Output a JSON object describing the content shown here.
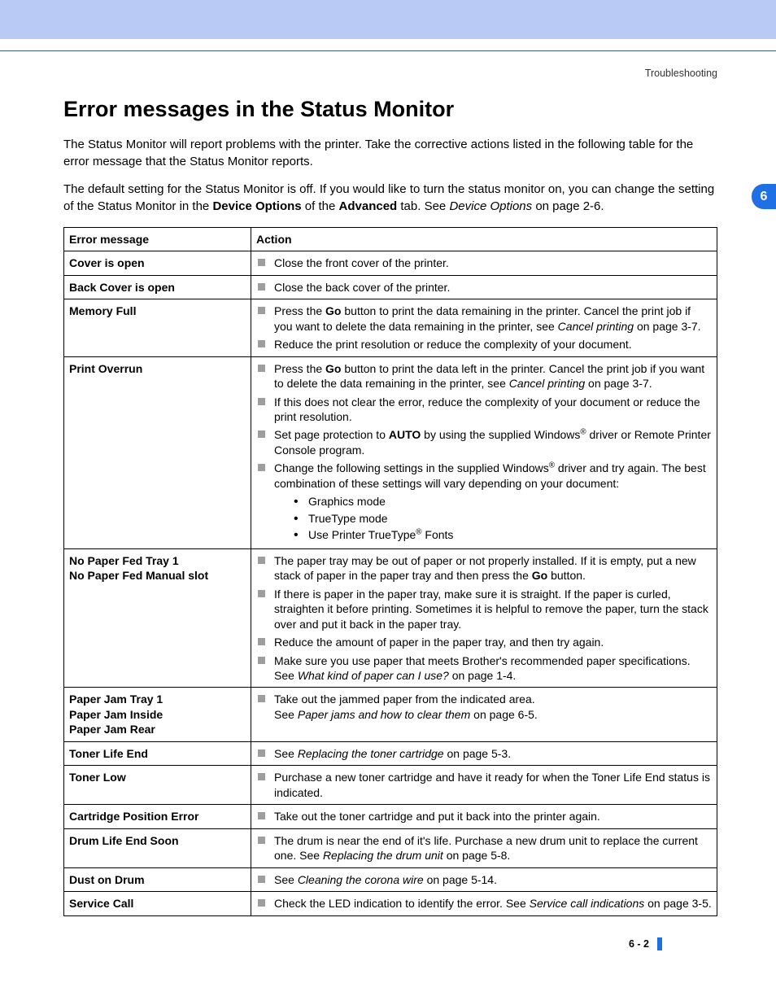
{
  "breadcrumb": "Troubleshooting",
  "chapter_tab": "6",
  "page_number": "6 - 2",
  "heading": "Error messages in the Status Monitor",
  "intro1": "The Status Monitor will report problems with the printer. Take the corrective actions listed in the following table for the error message that the Status Monitor reports.",
  "intro2_a": "The default setting for the Status Monitor is off. If you would like to turn the status monitor on, you can change the setting of the Status Monitor in the ",
  "intro2_b": "Device Options",
  "intro2_c": " of the ",
  "intro2_d": "Advanced",
  "intro2_e": " tab. See ",
  "intro2_f": "Device Options",
  "intro2_g": " on page 2-6.",
  "th_msg": "Error message",
  "th_act": "Action",
  "rows": {
    "cover": {
      "msg": "Cover is open",
      "a1": "Close the front cover of the printer."
    },
    "back": {
      "msg": "Back Cover is open",
      "a1": "Close the back cover of the printer."
    },
    "mem": {
      "msg": "Memory Full",
      "a1a": "Press the ",
      "a1b": "Go",
      "a1c": " button to print the data remaining in the printer. Cancel the print job if you want to delete the data remaining in the printer, see ",
      "a1d": "Cancel printing",
      "a1e": " on page 3-7.",
      "a2": "Reduce the print resolution or reduce the complexity of your document."
    },
    "over": {
      "msg": "Print Overrun",
      "a1a": "Press the ",
      "a1b": "Go",
      "a1c": " button to print the data left in the printer. Cancel the print job if you want to delete the data remaining in the printer, see ",
      "a1d": "Cancel printing",
      "a1e": " on page 3-7.",
      "a2": "If this does not clear the error, reduce the complexity of your document or reduce the print resolution.",
      "a3a": "Set page protection to ",
      "a3b": "AUTO",
      "a3c": " by using the supplied Windows",
      "a3d": " driver or Remote Printer Console program.",
      "a4a": "Change the following settings in the supplied Windows",
      "a4b": " driver and try again. The best combination of these settings will vary depending on your document:",
      "s1": "Graphics mode",
      "s2": "TrueType mode",
      "s3a": "Use Printer TrueType",
      "s3b": " Fonts"
    },
    "nopaper": {
      "msg1": "No Paper Fed Tray 1",
      "msg2": "No Paper Fed Manual slot",
      "a1a": "The paper tray may be out of paper or not properly installed. If it is empty, put a new stack of paper in the paper tray and then press the ",
      "a1b": "Go",
      "a1c": " button.",
      "a2": "If there is paper in the paper tray, make sure it is straight. If the paper is curled, straighten it before printing. Sometimes it is helpful to remove the paper, turn the stack over and put it back in the paper tray.",
      "a3": "Reduce the amount of paper in the paper tray, and then try again.",
      "a4a": "Make sure you use paper that meets Brother's recommended paper specifications. See ",
      "a4b": "What kind of paper can I use?",
      "a4c": " on page 1-4."
    },
    "jam": {
      "msg1": "Paper Jam Tray 1",
      "msg2": "Paper Jam Inside",
      "msg3": "Paper Jam Rear",
      "a1": "Take out the jammed paper from the indicated area.",
      "a1s_a": "See ",
      "a1s_b": "Paper jams and how to clear them",
      "a1s_c": " on page 6-5."
    },
    "tonerend": {
      "msg": "Toner Life End",
      "a1a": "See ",
      "a1b": "Replacing the toner cartridge",
      "a1c": " on page 5-3."
    },
    "tonerlow": {
      "msg": "Toner Low",
      "a1": "Purchase a new toner cartridge and have it ready for when the Toner Life End status is indicated."
    },
    "cart": {
      "msg": "Cartridge Position Error",
      "a1": "Take out the toner cartridge and put it back into the printer again."
    },
    "drum": {
      "msg": "Drum Life End Soon",
      "a1a": "The drum is near the end of it's life. Purchase a new drum unit to replace the current one. See ",
      "a1b": "Replacing the drum unit",
      "a1c": " on page 5-8."
    },
    "dust": {
      "msg": "Dust on Drum",
      "a1a": "See ",
      "a1b": "Cleaning the corona wire",
      "a1c": " on page 5-14."
    },
    "svc": {
      "msg": "Service Call",
      "a1a": "Check the LED indication to identify the error. See ",
      "a1b": "Service call indications",
      "a1c": " on page 3-5."
    }
  }
}
